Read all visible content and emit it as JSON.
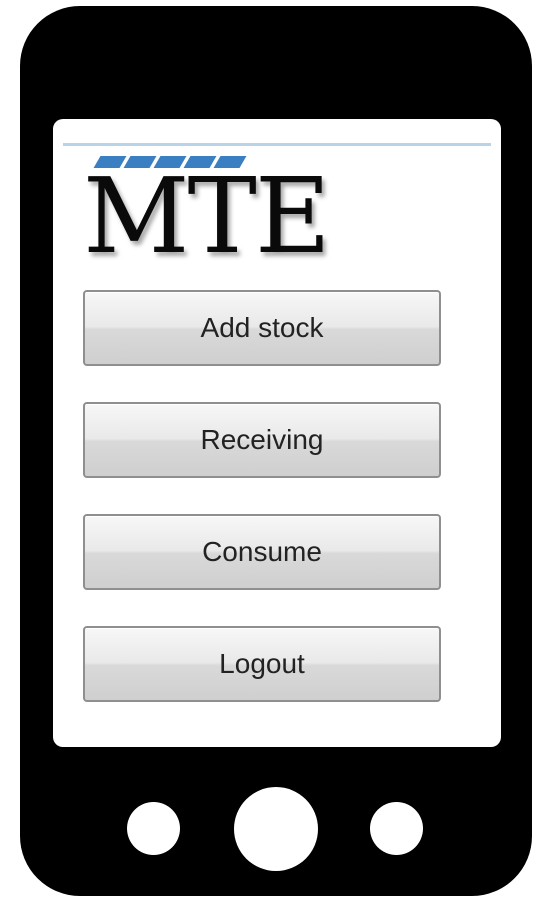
{
  "app": {
    "logo_text": "MTE"
  },
  "menu": {
    "buttons": [
      {
        "label": "Add stock"
      },
      {
        "label": "Receiving"
      },
      {
        "label": "Consume"
      },
      {
        "label": "Logout"
      }
    ]
  },
  "colors": {
    "device_body": "#000000",
    "screen_background": "#ffffff",
    "logo_accent": "#3a7fc1",
    "header_rule": "#b9d3e8",
    "button_border": "#8f8f8f"
  },
  "icons": {
    "logo_stripes": "speed-stripes-icon",
    "hardware_left": "device-back-button-icon",
    "hardware_center": "device-home-button-icon",
    "hardware_right": "device-menu-button-icon"
  }
}
